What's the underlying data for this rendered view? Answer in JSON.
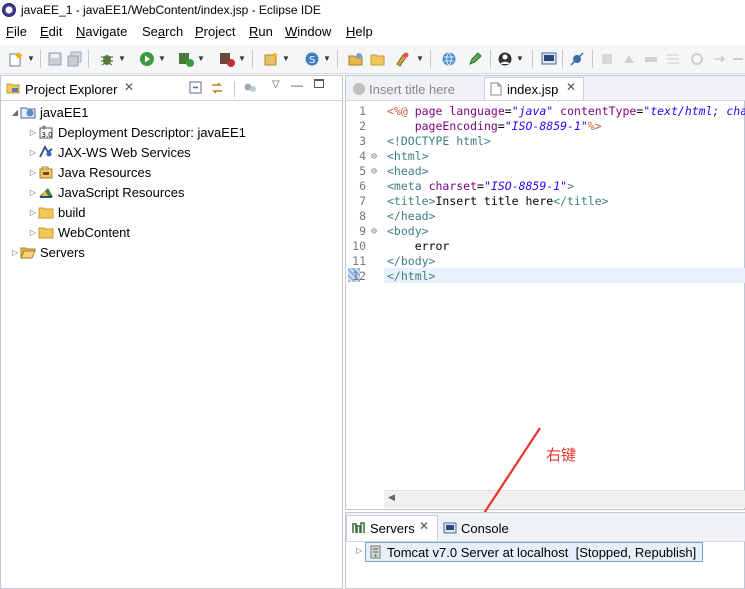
{
  "window": {
    "title": "javaEE_1 - javaEE1/WebContent/index.jsp - Eclipse IDE",
    "ghost_left": "",
    "ghost_right": ""
  },
  "menu": [
    "File",
    "Edit",
    "Navigate",
    "Search",
    "Project",
    "Run",
    "Window",
    "Help"
  ],
  "menu_mnemonics": [
    "F",
    "E",
    "N",
    "a",
    "P",
    "R",
    "W",
    "H"
  ],
  "project_explorer": {
    "tab_label": "Project Explorer",
    "tree": [
      {
        "label": "javaEE1",
        "level": 0,
        "expanded": true,
        "icon": "web-project-icon"
      },
      {
        "label": "Deployment Descriptor: javaEE1",
        "level": 1,
        "icon": "deployment-descriptor-icon"
      },
      {
        "label": "JAX-WS Web Services",
        "level": 1,
        "icon": "web-services-icon"
      },
      {
        "label": "Java Resources",
        "level": 1,
        "icon": "java-resources-icon"
      },
      {
        "label": "JavaScript Resources",
        "level": 1,
        "icon": "javascript-resources-icon"
      },
      {
        "label": "build",
        "level": 1,
        "icon": "folder-icon"
      },
      {
        "label": "WebContent",
        "level": 1,
        "icon": "folder-icon"
      },
      {
        "label": "Servers",
        "level": 0,
        "icon": "open-folder-icon"
      }
    ]
  },
  "editor": {
    "tabs": [
      {
        "label": "Insert title here",
        "active": false
      },
      {
        "label": "index.jsp",
        "active": true
      }
    ],
    "line_numbers": [
      "1",
      "2",
      "3",
      "4",
      "5",
      "6",
      "7",
      "8",
      "9",
      "10",
      "11",
      "12"
    ],
    "fold_markers": [
      "",
      "",
      "",
      "⊖",
      "⊖",
      "",
      "",
      "",
      "⊖",
      "",
      "",
      ""
    ]
  },
  "servers": {
    "tab_label": "Servers",
    "console_label": "Console",
    "entry": "Tomcat v7.0 Server at localhost  [Stopped, Republish]"
  },
  "annotation": {
    "text": "右键",
    "color": "#e8352c"
  }
}
